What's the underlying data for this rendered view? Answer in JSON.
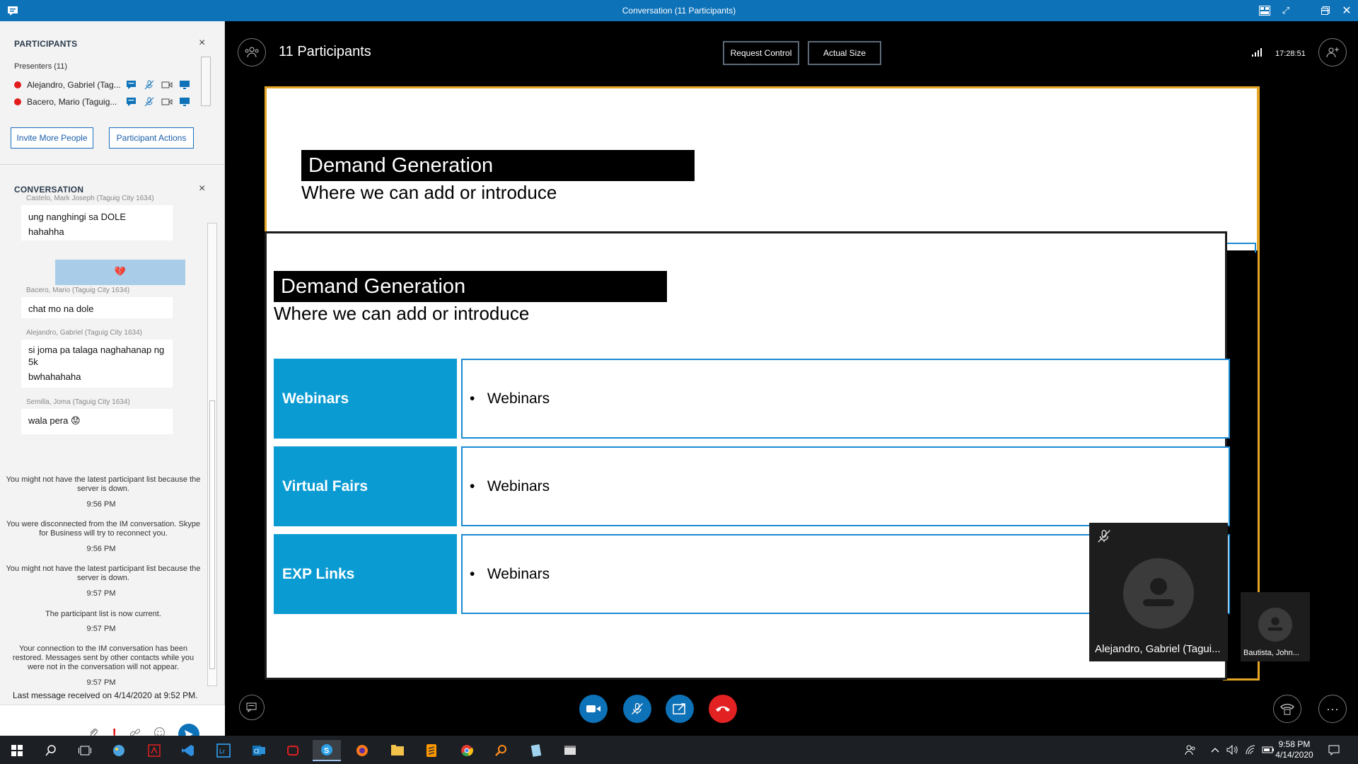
{
  "window": {
    "title": "Conversation (11 Participants)",
    "controls": [
      "layout-icon",
      "expand-icon",
      "restore-icon",
      "close-icon"
    ]
  },
  "participants": {
    "heading": "PARTICIPANTS",
    "presenters_label": "Presenters (11)",
    "items": [
      {
        "name": "Alejandro, Gabriel (Tag...",
        "status_color": "#e21b1b"
      },
      {
        "name": "Bacero, Mario (Taguig...",
        "status_color": "#e21b1b"
      }
    ],
    "invite_label": "Invite More People",
    "actions_label": "Participant Actions"
  },
  "conversation": {
    "heading": "CONVERSATION",
    "messages": [
      {
        "sender": "Castelo, Mark Joseph (Taguig City 1634)",
        "lines": [
          "ung nanghingi sa DOLE",
          "hahahha"
        ]
      },
      {
        "self": true,
        "emoji": "💔"
      },
      {
        "sender": "Bacero, Mario (Taguig City 1634)",
        "lines": [
          "chat mo na dole"
        ]
      },
      {
        "sender": "Alejandro, Gabriel (Taguig City 1634)",
        "lines": [
          "si joma pa talaga naghahanap ng 5k",
          "bwhahahaha"
        ]
      },
      {
        "sender": "Semilla, Joma (Taguig City 1634)",
        "lines": [
          "wala pera"
        ],
        "emoji": "😟"
      }
    ],
    "system": [
      {
        "text": "You might not have the latest participant list because the server is down.",
        "time": "9:56 PM"
      },
      {
        "text": "You were disconnected from the IM conversation. Skype for Business will try to reconnect you.",
        "time": "9:56 PM"
      },
      {
        "text": "You might not have the latest participant list because the server is down.",
        "time": "9:57 PM"
      },
      {
        "text": "The participant list is now current.",
        "time": "9:57 PM"
      },
      {
        "text": "Your connection to the IM conversation has been restored. Messages sent by other contacts while you were not in the conversation will not appear.",
        "time": "9:57 PM"
      }
    ],
    "last_message": "Last message received on 4/14/2020 at 9:52 PM."
  },
  "stage": {
    "participant_count": "11 Participants",
    "request_control": "Request Control",
    "actual_size": "Actual Size",
    "clock": "17:28:51",
    "slide": {
      "title": "Demand Generation",
      "subtitle": "Where we can add or introduce",
      "rows": [
        {
          "label": "Webinars",
          "bullet": "Webinars"
        },
        {
          "label": "Virtual Fairs",
          "bullet": "Webinars"
        },
        {
          "label": "EXP Links",
          "bullet": "Webinars"
        }
      ]
    },
    "video_main": "Alejandro, Gabriel (Tagui...",
    "video_small": "Bautista, John...",
    "accent_color": "#e5a526"
  },
  "taskbar": {
    "time": "9:58 PM",
    "date": "4/14/2020"
  }
}
